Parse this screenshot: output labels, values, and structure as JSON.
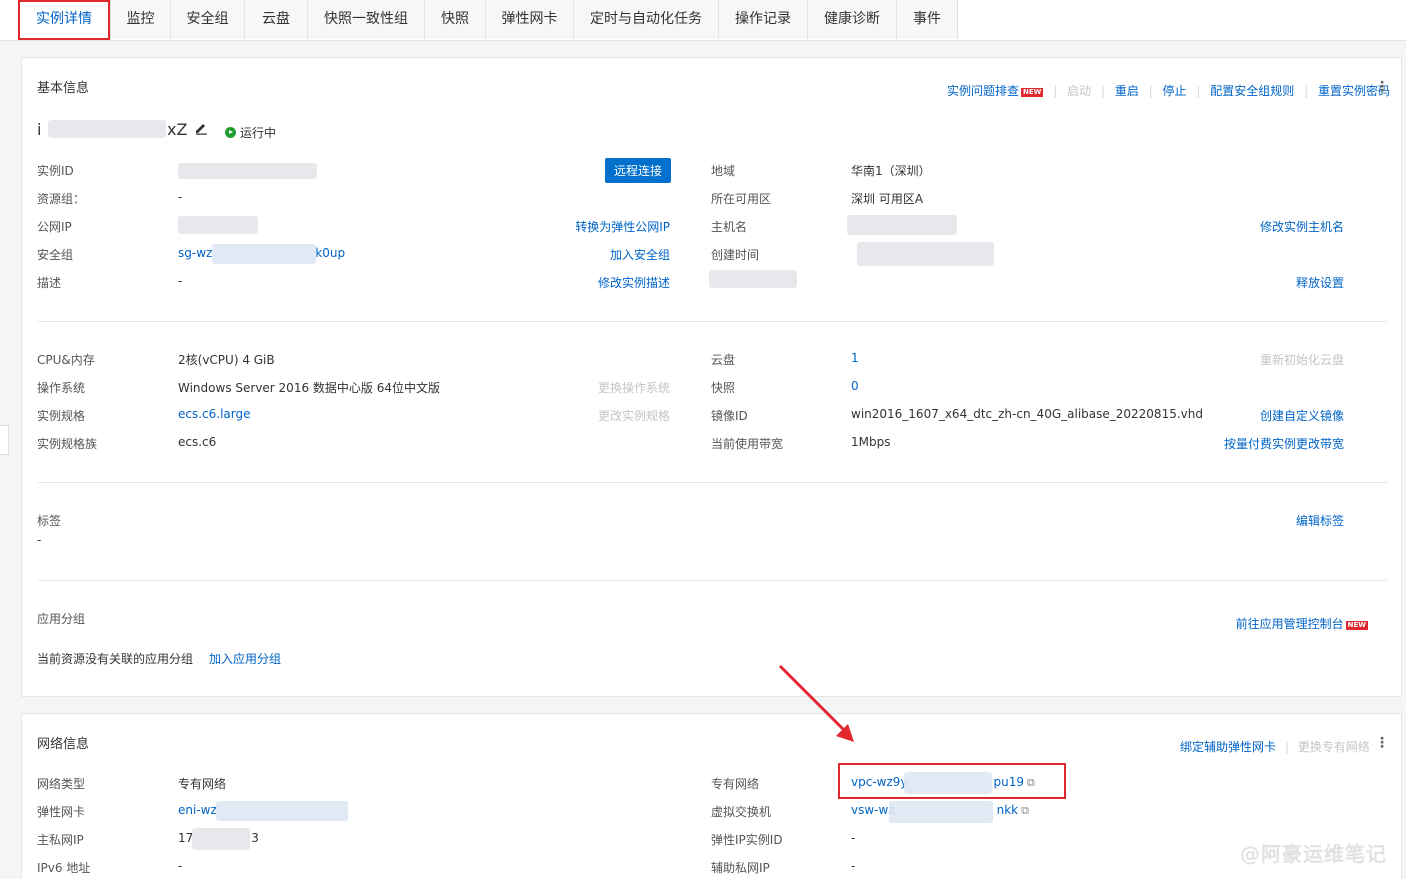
{
  "tabs": [
    "实例详情",
    "监控",
    "安全组",
    "云盘",
    "快照一致性组",
    "快照",
    "弹性网卡",
    "定时与自动化任务",
    "操作记录",
    "健康诊断",
    "事件"
  ],
  "basic": {
    "title": "基本信息",
    "actions": {
      "troubleshoot": "实例问题排查",
      "new_badge": "NEW",
      "start": "启动",
      "restart": "重启",
      "stop": "停止",
      "config_sg_rules": "配置安全组规则",
      "reset_password": "重置实例密码"
    },
    "instance_name_prefix": "i",
    "instance_name_suffix": "xZ",
    "status": "运行中",
    "remote_connect": "远程连接",
    "left": [
      {
        "label": "实例ID",
        "value": ""
      },
      {
        "label": "资源组：",
        "value": "-"
      },
      {
        "label": "公网IP",
        "value": "",
        "action": "转换为弹性公网IP"
      },
      {
        "label": "安全组",
        "value": "sg-wz",
        "value_tail": "k0up",
        "action": "加入安全组"
      },
      {
        "label": "描述",
        "value": "-",
        "action": "修改实例描述"
      }
    ],
    "right": [
      {
        "label": "地域",
        "value": "华南1（深圳）"
      },
      {
        "label": "所在可用区",
        "value": "深圳 可用区A"
      },
      {
        "label": "主机名",
        "value": "",
        "action": "修改实例主机名"
      },
      {
        "label": "创建时间",
        "value": ""
      },
      {
        "label": "",
        "value": "",
        "action": "释放设置"
      }
    ]
  },
  "spec": {
    "left": [
      {
        "label": "CPU&内存",
        "value": "2核(vCPU) 4 GiB"
      },
      {
        "label": "操作系统",
        "value": "Windows Server 2016 数据中心版 64位中文版",
        "action": "更换操作系统"
      },
      {
        "label": "实例规格",
        "value": "ecs.c6.large",
        "action": "更改实例规格"
      },
      {
        "label": "实例规格族",
        "value": "ecs.c6"
      }
    ],
    "right": [
      {
        "label": "云盘",
        "value": "1",
        "action": "重新初始化云盘"
      },
      {
        "label": "快照",
        "value": "0"
      },
      {
        "label": "镜像ID",
        "value": "win2016_1607_x64_dtc_zh-cn_40G_alibase_20220815.vhd",
        "action": "创建自定义镜像"
      },
      {
        "label": "当前使用带宽",
        "value": "1Mbps",
        "action": "按量付费实例更改带宽"
      }
    ]
  },
  "tags": {
    "label": "标签",
    "value": "-",
    "action": "编辑标签"
  },
  "app_group": {
    "label": "应用分组",
    "action": "前往应用管理控制台",
    "new_badge": "NEW",
    "empty_text": "当前资源没有关联的应用分组",
    "join": "加入应用分组"
  },
  "network": {
    "title": "网络信息",
    "actions": {
      "bind_eni": "绑定辅助弹性网卡",
      "change_vpc": "更换专有网络"
    },
    "left": [
      {
        "label": "网络类型",
        "value": "专有网络"
      },
      {
        "label": "弹性网卡",
        "value": "eni-wz"
      },
      {
        "label": "主私网IP",
        "value": "17",
        "value_tail": "3"
      },
      {
        "label": "IPv6 地址",
        "value": "-"
      }
    ],
    "right": [
      {
        "label": "专有网络",
        "value": "vpc-wz9y",
        "value_tail": "pu19"
      },
      {
        "label": "虚拟交换机",
        "value": "vsw-wz",
        "value_tail": "nkk"
      },
      {
        "label": "弹性IP实例ID",
        "value": "-"
      },
      {
        "label": "辅助私网IP",
        "value": "-"
      }
    ]
  },
  "watermark": "@阿豪运维笔记",
  "icons": {
    "edit": "pencil-icon",
    "status": "play-circle-icon",
    "external": "external-link-icon",
    "more": "more-vertical-icon"
  },
  "colors": {
    "accent": "#0064c8",
    "highlight": "#e0282e",
    "success": "#1e9e2f"
  }
}
